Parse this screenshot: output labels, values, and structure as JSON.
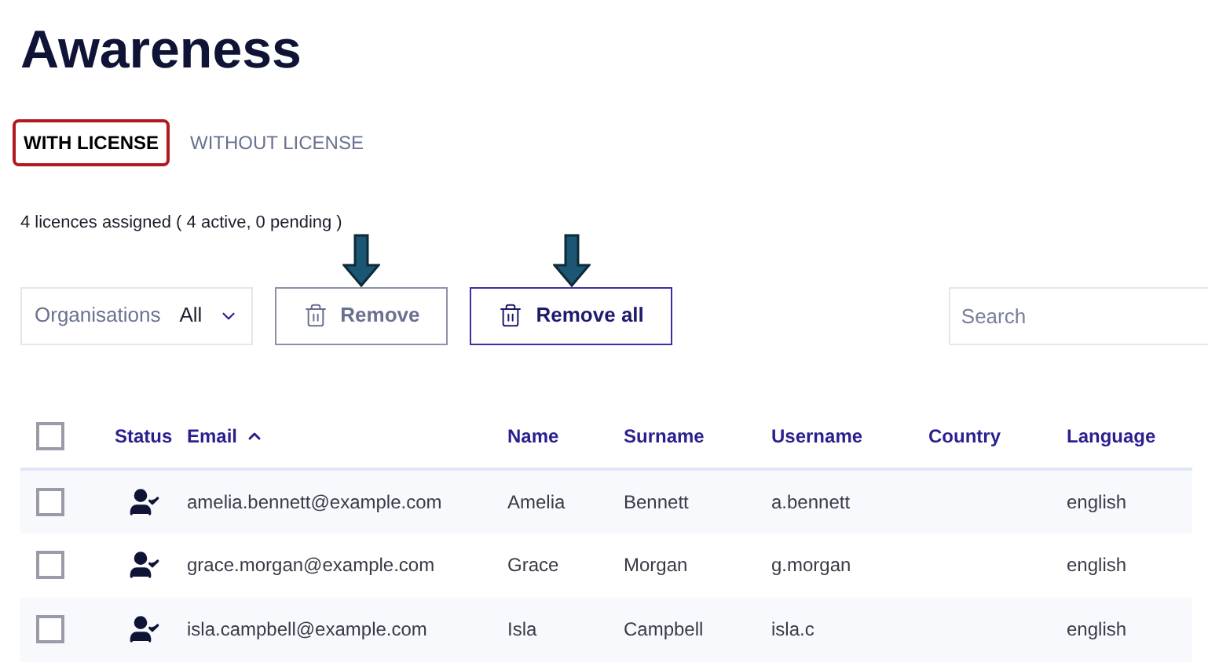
{
  "page_title": "Awareness",
  "tabs": [
    {
      "label": "WITH LICENSE",
      "selected": true
    },
    {
      "label": "WITHOUT LICENSE",
      "selected": false
    }
  ],
  "summary": "4 licences assigned ( 4 active, 0 pending )",
  "toolbar": {
    "filter": {
      "label": "Organisations",
      "value": "All"
    },
    "buttons": [
      {
        "label": "Remove",
        "disabled": true,
        "annotated": true
      },
      {
        "label": "Remove all",
        "disabled": false,
        "annotated": true
      }
    ],
    "search": {
      "placeholder": "Search"
    }
  },
  "table": {
    "select_all_checked": false,
    "columns": [
      {
        "label": "Status",
        "sorted": false
      },
      {
        "label": "Email",
        "sorted": true
      },
      {
        "label": "Name",
        "sorted": false
      },
      {
        "label": "Surname",
        "sorted": false
      },
      {
        "label": "Username",
        "sorted": false
      },
      {
        "label": "Country",
        "sorted": false
      },
      {
        "label": "Language",
        "sorted": false
      }
    ],
    "rows": [
      {
        "checked": false,
        "kind": "active",
        "email": "amelia.bennett@example.com",
        "name": "Amelia",
        "surname": "Bennett",
        "username": "a.bennett",
        "language": "english"
      },
      {
        "checked": false,
        "kind": "active",
        "email": "grace.morgan@example.com",
        "name": "Grace",
        "surname": "Morgan",
        "username": "g.morgan",
        "language": "english"
      },
      {
        "checked": false,
        "kind": "active",
        "email": "isla.campbell@example.com",
        "name": "Isla",
        "surname": "Campbell",
        "username": "isla.c",
        "language": "english"
      }
    ]
  }
}
